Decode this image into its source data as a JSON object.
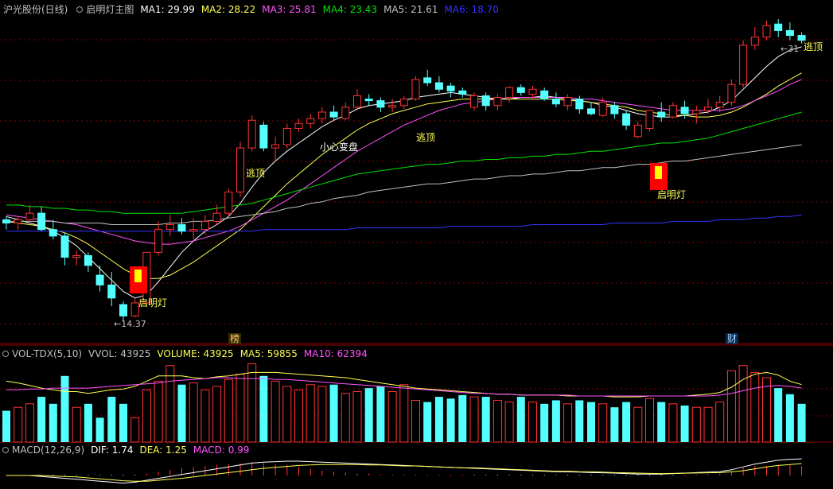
{
  "main_legend": {
    "stock_name": "沪光股份(日线)",
    "indicator_name": "启明灯主图",
    "ma": [
      {
        "label": "MA1: 29.99",
        "color": "#ffffff"
      },
      {
        "label": "MA2: 28.22",
        "color": "#ffff54"
      },
      {
        "label": "MA3: 25.81",
        "color": "#ff54ff"
      },
      {
        "label": "MA4: 23.43",
        "color": "#00e600"
      },
      {
        "label": "MA5: 21.61",
        "color": "#c0c0c0"
      },
      {
        "label": "MA6: 18.70",
        "color": "#3333ff"
      }
    ]
  },
  "vol_legend": {
    "items": [
      {
        "label": "VOL-TDX(5,10)",
        "color": "#c0c0c0"
      },
      {
        "label": "VVOL: 43925",
        "color": "#c0c0c0"
      },
      {
        "label": "VOLUME: 43925",
        "color": "#ffff54"
      },
      {
        "label": "MA5: 59855",
        "color": "#ffff54"
      },
      {
        "label": "MA10: 62394",
        "color": "#ff54ff"
      }
    ]
  },
  "macd_legend": {
    "items": [
      {
        "label": "MACD(12,26,9)",
        "color": "#c0c0c0"
      },
      {
        "label": "DIF: 1.74",
        "color": "#ffffff"
      },
      {
        "label": "DEA: 1.25",
        "color": "#ffff54"
      },
      {
        "label": "MACD: 0.99",
        "color": "#ff54ff"
      }
    ]
  },
  "annotations": {
    "signal_label": "启明灯",
    "escape_label": "逃顶",
    "caution_label": "小心变盘",
    "low_label": "←14.37",
    "high_label": "←31",
    "event_bang": "榜",
    "event_cai": "财"
  },
  "chart_data": {
    "type": "candlestick",
    "price_range": [
      13.5,
      33.0
    ],
    "candles": [
      [
        20.6,
        20.8,
        20.0,
        20.4
      ],
      [
        20.4,
        20.8,
        20.0,
        20.6
      ],
      [
        20.6,
        21.5,
        20.4,
        21.0
      ],
      [
        21.0,
        21.4,
        19.9,
        20.0
      ],
      [
        20.0,
        20.6,
        19.4,
        19.6
      ],
      [
        19.6,
        19.8,
        17.8,
        18.3
      ],
      [
        18.3,
        18.7,
        17.8,
        18.4
      ],
      [
        18.4,
        18.6,
        17.4,
        17.8
      ],
      [
        17.2,
        17.8,
        16.2,
        16.6
      ],
      [
        16.6,
        17.4,
        15.3,
        15.8
      ],
      [
        15.4,
        15.6,
        14.37,
        14.7
      ],
      [
        14.7,
        15.8,
        14.6,
        15.5
      ],
      [
        15.5,
        18.6,
        15.4,
        18.6
      ],
      [
        18.6,
        20.5,
        18.4,
        20.0
      ],
      [
        20.0,
        20.9,
        19.6,
        20.3
      ],
      [
        20.3,
        20.7,
        19.7,
        19.9
      ],
      [
        19.9,
        20.7,
        19.4,
        20.0
      ],
      [
        20.0,
        20.9,
        19.7,
        20.5
      ],
      [
        20.5,
        21.5,
        20.3,
        21.0
      ],
      [
        21.0,
        22.5,
        20.8,
        22.3
      ],
      [
        22.3,
        25.4,
        22.0,
        25.0
      ],
      [
        25.0,
        27.0,
        24.8,
        26.7
      ],
      [
        26.4,
        26.6,
        24.8,
        25.0
      ],
      [
        25.0,
        25.7,
        24.2,
        25.2
      ],
      [
        25.2,
        26.5,
        25.0,
        26.2
      ],
      [
        26.2,
        26.8,
        26.0,
        26.5
      ],
      [
        26.5,
        27.1,
        26.2,
        26.8
      ],
      [
        26.8,
        27.5,
        26.5,
        27.2
      ],
      [
        27.2,
        27.6,
        26.7,
        26.9
      ],
      [
        26.8,
        27.8,
        26.7,
        27.5
      ],
      [
        27.5,
        28.6,
        27.3,
        28.2
      ],
      [
        28.0,
        28.3,
        27.6,
        27.9
      ],
      [
        27.9,
        28.1,
        27.2,
        27.5
      ],
      [
        27.5,
        28.0,
        27.2,
        27.6
      ],
      [
        27.6,
        28.2,
        27.4,
        28.0
      ],
      [
        28.0,
        29.4,
        27.9,
        29.2
      ],
      [
        29.3,
        29.8,
        28.8,
        29.0
      ],
      [
        29.0,
        29.4,
        28.4,
        28.6
      ],
      [
        28.8,
        29.0,
        28.1,
        28.5
      ],
      [
        28.5,
        28.7,
        28.1,
        28.3
      ],
      [
        27.5,
        28.4,
        27.3,
        28.2
      ],
      [
        28.2,
        28.4,
        27.3,
        27.6
      ],
      [
        27.6,
        28.3,
        27.3,
        28.1
      ],
      [
        28.1,
        28.8,
        27.8,
        28.7
      ],
      [
        28.7,
        28.9,
        28.2,
        28.4
      ],
      [
        28.3,
        28.8,
        28.0,
        28.6
      ],
      [
        28.5,
        28.7,
        27.9,
        28.0
      ],
      [
        28.0,
        28.4,
        27.5,
        27.7
      ],
      [
        27.6,
        28.3,
        27.3,
        28.1
      ],
      [
        28.0,
        28.2,
        27.1,
        27.4
      ],
      [
        27.4,
        27.8,
        27.0,
        27.1
      ],
      [
        27.0,
        28.1,
        26.9,
        27.8
      ],
      [
        27.6,
        27.8,
        26.8,
        27.1
      ],
      [
        27.1,
        27.3,
        26.1,
        26.4
      ],
      [
        25.7,
        26.6,
        25.6,
        26.4
      ],
      [
        26.2,
        27.3,
        26.0,
        27.3
      ],
      [
        27.2,
        27.8,
        26.6,
        26.9
      ],
      [
        26.9,
        27.8,
        26.8,
        27.6
      ],
      [
        27.5,
        27.9,
        26.8,
        27.1
      ],
      [
        27.1,
        27.6,
        26.5,
        27.3
      ],
      [
        27.3,
        28.0,
        27.1,
        27.5
      ],
      [
        27.5,
        28.2,
        27.2,
        27.8
      ],
      [
        27.8,
        29.2,
        27.6,
        28.9
      ],
      [
        28.9,
        31.6,
        28.7,
        31.3
      ],
      [
        31.3,
        32.4,
        31.0,
        31.8
      ],
      [
        31.8,
        32.8,
        31.6,
        32.5
      ],
      [
        32.6,
        32.9,
        31.8,
        32.2
      ],
      [
        32.2,
        32.7,
        31.6,
        31.9
      ],
      [
        31.9,
        32.1,
        31.4,
        31.6
      ]
    ],
    "volume_ma5": [
      70,
      68,
      65,
      62,
      60,
      58,
      58,
      56,
      58,
      60,
      61,
      64,
      70,
      76,
      76,
      76,
      74,
      73,
      75,
      76,
      78,
      80,
      80,
      80,
      79,
      78,
      77,
      76,
      75,
      74,
      72,
      70,
      68,
      66,
      64,
      62,
      61,
      60,
      59,
      58,
      57,
      56,
      55,
      55,
      54,
      54,
      54,
      54,
      53,
      53,
      53,
      53,
      52,
      52,
      52,
      53,
      53,
      53,
      53,
      54,
      55,
      57,
      63,
      72,
      78,
      80,
      77,
      70,
      66
    ],
    "volume_ma10": [
      60,
      60,
      61,
      61,
      62,
      62,
      62,
      62,
      63,
      64,
      65,
      66,
      67,
      68,
      70,
      71,
      72,
      73,
      74,
      74,
      73,
      73,
      73,
      72,
      72,
      71,
      70,
      69,
      68,
      67,
      66,
      65,
      64,
      63,
      62,
      61,
      60,
      59,
      58,
      57,
      56,
      56,
      55,
      55,
      54,
      54,
      54,
      54,
      54,
      53,
      53,
      53,
      53,
      53,
      53,
      53,
      53,
      53,
      53,
      53,
      53,
      54,
      56,
      59,
      62,
      64,
      65,
      64,
      62
    ],
    "volumes": [
      36,
      40,
      44,
      52,
      44,
      76,
      40,
      44,
      28,
      52,
      44,
      28,
      60,
      70,
      88,
      66,
      68,
      60,
      64,
      72,
      78,
      90,
      76,
      70,
      64,
      60,
      66,
      64,
      66,
      56,
      58,
      62,
      64,
      58,
      66,
      48,
      46,
      52,
      50,
      54,
      52,
      52,
      48,
      46,
      52,
      46,
      44,
      48,
      44,
      48,
      46,
      44,
      40,
      46,
      40,
      50,
      46,
      44,
      42,
      40,
      40,
      46,
      82,
      88,
      80,
      74,
      62,
      55,
      44
    ],
    "macd_dif": [
      0,
      0,
      0,
      -0.1,
      -0.2,
      -0.3,
      -0.4,
      -0.5,
      -0.6,
      -0.7,
      -0.8,
      -0.7,
      -0.5,
      -0.3,
      -0.1,
      0.1,
      0.3,
      0.5,
      0.7,
      0.9,
      1.1,
      1.3,
      1.4,
      1.45,
      1.5,
      1.5,
      1.45,
      1.4,
      1.35,
      1.3,
      1.25,
      1.2,
      1.15,
      1.1,
      1.05,
      1.0,
      0.95,
      0.9,
      0.85,
      0.8,
      0.75,
      0.7,
      0.65,
      0.6,
      0.55,
      0.5,
      0.45,
      0.4,
      0.38,
      0.35,
      0.3,
      0.28,
      0.25,
      0.2,
      0.15,
      0.15,
      0.15,
      0.2,
      0.25,
      0.3,
      0.35,
      0.4,
      0.6,
      0.9,
      1.2,
      1.4,
      1.6,
      1.7,
      1.74
    ],
    "macd_dea": [
      0,
      0,
      0,
      0,
      -0.05,
      -0.1,
      -0.15,
      -0.25,
      -0.35,
      -0.45,
      -0.55,
      -0.6,
      -0.6,
      -0.5,
      -0.4,
      -0.3,
      -0.15,
      0,
      0.15,
      0.3,
      0.45,
      0.6,
      0.75,
      0.85,
      0.95,
      1.05,
      1.1,
      1.15,
      1.15,
      1.15,
      1.15,
      1.1,
      1.1,
      1.05,
      1.0,
      1.0,
      0.95,
      0.9,
      0.85,
      0.8,
      0.8,
      0.75,
      0.7,
      0.65,
      0.6,
      0.55,
      0.5,
      0.45,
      0.45,
      0.4,
      0.38,
      0.35,
      0.3,
      0.28,
      0.25,
      0.22,
      0.2,
      0.22,
      0.24,
      0.26,
      0.28,
      0.3,
      0.38,
      0.5,
      0.7,
      0.9,
      1.05,
      1.15,
      1.25
    ],
    "ma_lines": {
      "ma1": [
        20.8,
        20.6,
        20.4,
        20.2,
        19.9,
        19.5,
        19.0,
        18.3,
        17.6,
        16.9,
        16.2,
        15.8,
        16.0,
        16.8,
        17.7,
        18.6,
        19.3,
        19.9,
        20.3,
        20.8,
        21.6,
        22.6,
        23.5,
        24.2,
        24.8,
        25.3,
        25.8,
        26.3,
        26.7,
        27.0,
        27.4,
        27.6,
        27.7,
        27.8,
        27.9,
        28.1,
        28.2,
        28.3,
        28.4,
        28.3,
        28.2,
        28.1,
        28.0,
        28.0,
        28.1,
        28.1,
        28.2,
        28.1,
        28.0,
        27.9,
        27.8,
        27.6,
        27.5,
        27.3,
        27.1,
        27.0,
        26.9,
        26.9,
        27.0,
        27.1,
        27.2,
        27.5,
        27.9,
        28.6,
        29.3,
        30.0,
        30.6,
        31.0,
        31.2
      ],
      "ma2": [
        20.5,
        20.4,
        20.3,
        20.2,
        20.0,
        19.8,
        19.5,
        19.1,
        18.6,
        18.1,
        17.6,
        17.2,
        17.0,
        17.0,
        17.2,
        17.6,
        18.0,
        18.5,
        19.0,
        19.5,
        20.0,
        20.7,
        21.4,
        22.1,
        22.8,
        23.4,
        24.0,
        24.6,
        25.1,
        25.6,
        26.1,
        26.5,
        26.8,
        27.1,
        27.3,
        27.5,
        27.7,
        27.8,
        27.9,
        28.0,
        28.0,
        28.0,
        28.0,
        28.0,
        28.0,
        28.0,
        28.0,
        28.0,
        27.9,
        27.9,
        27.8,
        27.7,
        27.6,
        27.5,
        27.3,
        27.2,
        27.1,
        27.0,
        27.0,
        26.9,
        26.9,
        27.0,
        27.2,
        27.5,
        27.9,
        28.3,
        28.8,
        29.2,
        29.6
      ],
      "ma3": [
        20.9,
        20.8,
        20.7,
        20.6,
        20.5,
        20.4,
        20.3,
        20.1,
        19.9,
        19.7,
        19.5,
        19.3,
        19.2,
        19.1,
        19.1,
        19.2,
        19.3,
        19.5,
        19.7,
        19.9,
        20.2,
        20.6,
        21.0,
        21.4,
        21.8,
        22.3,
        22.8,
        23.3,
        23.8,
        24.3,
        24.8,
        25.2,
        25.6,
        26.0,
        26.4,
        26.7,
        27.0,
        27.3,
        27.5,
        27.7,
        27.8,
        27.9,
        28.0,
        28.1,
        28.1,
        28.1,
        28.1,
        28.1,
        28.1,
        28.0,
        28.0,
        27.9,
        27.8,
        27.7,
        27.6,
        27.5,
        27.4,
        27.3,
        27.3,
        27.3,
        27.3,
        27.3,
        27.4,
        27.6,
        27.9,
        28.2,
        28.5,
        28.9,
        29.2
      ],
      "ma4": [
        21.5,
        21.5,
        21.4,
        21.4,
        21.3,
        21.3,
        21.2,
        21.2,
        21.1,
        21.1,
        21.0,
        21.0,
        21.0,
        21.0,
        21.0,
        21.0,
        21.1,
        21.2,
        21.3,
        21.4,
        21.5,
        21.6,
        21.8,
        22.0,
        22.2,
        22.4,
        22.6,
        22.8,
        23.0,
        23.2,
        23.4,
        23.5,
        23.6,
        23.7,
        23.8,
        23.9,
        24.0,
        24.0,
        24.1,
        24.2,
        24.2,
        24.3,
        24.3,
        24.4,
        24.4,
        24.5,
        24.5,
        24.6,
        24.6,
        24.7,
        24.8,
        24.8,
        24.9,
        25.0,
        25.1,
        25.2,
        25.3,
        25.3,
        25.4,
        25.5,
        25.6,
        25.8,
        26.0,
        26.2,
        26.4,
        26.6,
        26.8,
        27.0,
        27.2
      ],
      "ma5": [
        20.5,
        20.5,
        20.5,
        20.5,
        20.5,
        20.4,
        20.4,
        20.4,
        20.4,
        20.3,
        20.3,
        20.3,
        20.3,
        20.3,
        20.4,
        20.4,
        20.5,
        20.5,
        20.6,
        20.7,
        20.8,
        20.9,
        21.0,
        21.1,
        21.3,
        21.4,
        21.6,
        21.7,
        21.9,
        22.0,
        22.1,
        22.3,
        22.4,
        22.5,
        22.6,
        22.7,
        22.8,
        22.8,
        22.9,
        23.0,
        23.1,
        23.1,
        23.2,
        23.3,
        23.3,
        23.4,
        23.4,
        23.5,
        23.6,
        23.6,
        23.7,
        23.8,
        23.8,
        23.9,
        24.0,
        24.0,
        24.1,
        24.2,
        24.2,
        24.3,
        24.4,
        24.5,
        24.6,
        24.7,
        24.8,
        24.9,
        25.0,
        25.1,
        25.2
      ],
      "ma6": [
        19.9,
        19.9,
        19.9,
        19.9,
        19.9,
        19.9,
        19.9,
        19.9,
        19.9,
        19.9,
        19.9,
        19.9,
        19.9,
        19.9,
        19.9,
        19.9,
        19.9,
        19.9,
        19.9,
        19.9,
        19.9,
        19.9,
        20.0,
        20.0,
        20.0,
        20.0,
        20.0,
        20.0,
        20.0,
        20.0,
        20.1,
        20.1,
        20.1,
        20.1,
        20.1,
        20.1,
        20.1,
        20.1,
        20.2,
        20.2,
        20.2,
        20.2,
        20.2,
        20.2,
        20.2,
        20.3,
        20.3,
        20.3,
        20.3,
        20.3,
        20.3,
        20.3,
        20.4,
        20.4,
        20.4,
        20.4,
        20.4,
        20.5,
        20.5,
        20.5,
        20.5,
        20.6,
        20.6,
        20.6,
        20.7,
        20.7,
        20.8,
        20.8,
        20.9
      ]
    }
  }
}
